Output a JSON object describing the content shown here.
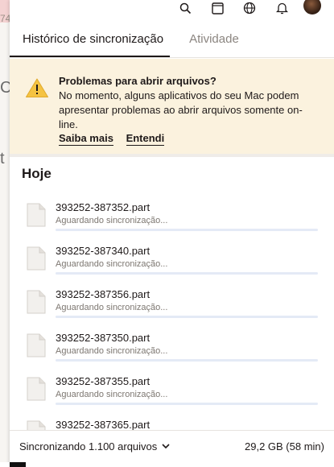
{
  "background": {
    "left_text": "74",
    "letters": [
      "C",
      "t"
    ]
  },
  "topbar": {
    "icons": [
      "search-icon",
      "window-icon",
      "globe-icon",
      "bell-icon",
      "avatar"
    ]
  },
  "tabs": [
    {
      "label": "Histórico de sincronização",
      "active": true
    },
    {
      "label": "Atividade",
      "active": false
    }
  ],
  "banner": {
    "title": "Problemas para abrir arquivos?",
    "message": "No momento, alguns aplicativos do seu Mac podem apresentar problemas ao abrir arquivos somente on-line.",
    "link_learn": "Saiba mais",
    "link_ok": "Entendi"
  },
  "section_title": "Hoje",
  "files": [
    {
      "name": "393252-387352.part",
      "status": "Aguardando sincronização..."
    },
    {
      "name": "393252-387340.part",
      "status": "Aguardando sincronização..."
    },
    {
      "name": "393252-387356.part",
      "status": "Aguardando sincronização..."
    },
    {
      "name": "393252-387350.part",
      "status": "Aguardando sincronização..."
    },
    {
      "name": "393252-387355.part",
      "status": "Aguardando sincronização..."
    },
    {
      "name": "393252-387365.part",
      "status": ""
    }
  ],
  "footer": {
    "sync_label": "Sincronizando 1.100 arquivos",
    "size_label": "29,2 GB (58 min)"
  },
  "colors": {
    "banner_bg": "#fbf2de",
    "warning": "#f5c342",
    "progress_track": "#e4eaf6"
  }
}
